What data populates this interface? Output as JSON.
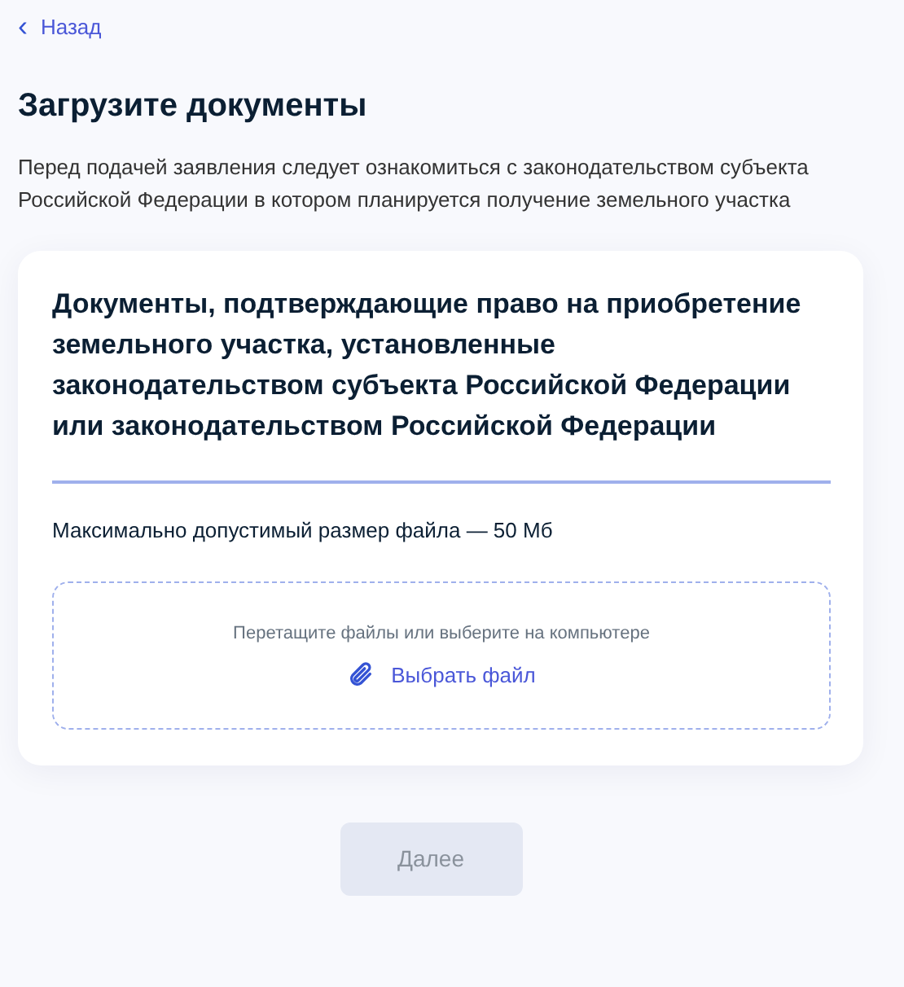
{
  "back_link": {
    "icon": "‹",
    "label": "Назад"
  },
  "title": "Загрузите документы",
  "description": "Перед подачей заявления следует ознакомиться с законодательством субъекта Российской Федерации в котором планируется получение земельного участка",
  "card": {
    "title": "Документы, подтверждающие право на приобретение земельного участка, установленные законодательством субъекта Российской Федерации или законодательством Российской Федерации",
    "max_size_note": "Максимально допустимый размер файла — 50 Мб",
    "dropzone": {
      "hint": "Перетащите файлы или выберите на компьютере",
      "button": "Выбрать файл"
    }
  },
  "next_button": {
    "label": "Далее",
    "disabled": true
  }
}
